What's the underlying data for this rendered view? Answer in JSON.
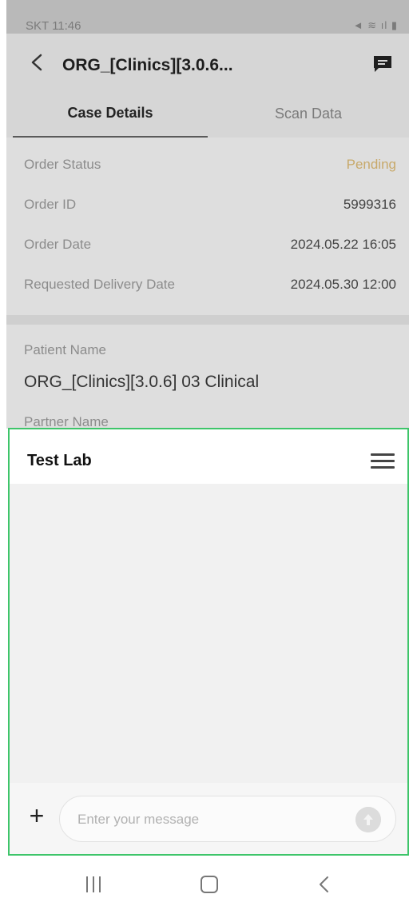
{
  "status_bar": {
    "time": "SKT 11:46",
    "icons": "◄ ≋ ıl ▮"
  },
  "header": {
    "title": "ORG_[Clinics][3.0.6...",
    "back_icon": "chevron-left-icon",
    "chat_icon": "chat-bubble-icon"
  },
  "tabs": [
    {
      "label": "Case Details",
      "active": true
    },
    {
      "label": "Scan Data",
      "active": false
    }
  ],
  "order_details": [
    {
      "label": "Order Status",
      "value": "Pending",
      "value_color": "#c8a96a"
    },
    {
      "label": "Order ID",
      "value": "5999316"
    },
    {
      "label": "Order Date",
      "value": "2024.05.22 16:05"
    },
    {
      "label": "Requested Delivery Date",
      "value": "2024.05.30 12:00"
    }
  ],
  "patient": {
    "label": "Patient Name",
    "value": "ORG_[Clinics][3.0.6] 03 Clinical",
    "partner_label": "Partner Name"
  },
  "chat": {
    "title": "Test Lab",
    "menu_icon": "hamburger-menu-icon",
    "attach_icon": "plus-icon",
    "attach_label": "+",
    "message_placeholder": "Enter your message",
    "send_icon": "send-icon",
    "border_color": "#3ec56a"
  },
  "nav_bar": {
    "recent_icon": "recent-apps-icon",
    "home_icon": "home-icon",
    "back_icon": "back-icon"
  }
}
